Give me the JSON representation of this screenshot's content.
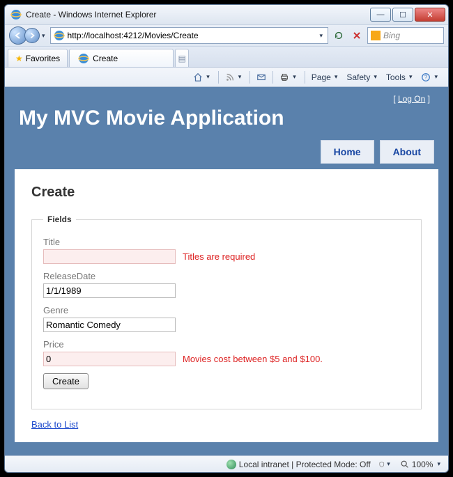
{
  "window": {
    "title": "Create - Windows Internet Explorer"
  },
  "address": {
    "url": "http://localhost:4212/Movies/Create"
  },
  "search": {
    "placeholder": "Bing"
  },
  "favorites": {
    "label": "Favorites"
  },
  "tab": {
    "label": "Create"
  },
  "cmdbar": {
    "page": "Page",
    "safety": "Safety",
    "tools": "Tools"
  },
  "logon": {
    "left": "[",
    "link": "Log On",
    "right": "]"
  },
  "app": {
    "title": "My MVC Movie Application"
  },
  "nav": {
    "home": "Home",
    "about": "About"
  },
  "content": {
    "heading": "Create",
    "legend": "Fields",
    "title": {
      "label": "Title",
      "value": "",
      "error": "Titles are required"
    },
    "releaseDate": {
      "label": "ReleaseDate",
      "value": "1/1/1989"
    },
    "genre": {
      "label": "Genre",
      "value": "Romantic Comedy"
    },
    "price": {
      "label": "Price",
      "value": "0",
      "error": "Movies cost between $5 and $100."
    },
    "submit": "Create",
    "back": "Back to List"
  },
  "status": {
    "zone": "Local intranet | Protected Mode: Off",
    "zoom": "100%"
  }
}
